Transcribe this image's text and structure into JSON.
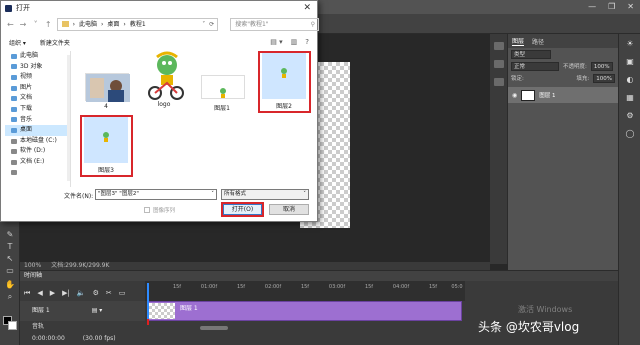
{
  "dialog": {
    "title": "打开",
    "close_glyph": "✕",
    "nav_back": "←",
    "nav_forward": "→",
    "nav_dropdown": "˅",
    "nav_up": "↑",
    "address": {
      "segments": [
        "›",
        "此电脑",
        "›",
        "桌面",
        "›",
        "教程1"
      ],
      "dropdown": "˅",
      "refresh": "⟳"
    },
    "search_placeholder": "搜索\"教程1\"",
    "search_icon": "⚲",
    "organize": "组织 ▾",
    "new_folder": "新建文件夹",
    "view_icons": [
      "▤ ▾",
      "▥",
      "?"
    ],
    "nav_items": [
      {
        "label": "此电脑",
        "kind": "pc"
      },
      {
        "label": "3D 对象",
        "kind": "folder"
      },
      {
        "label": "视频",
        "kind": "folder"
      },
      {
        "label": "图片",
        "kind": "folder"
      },
      {
        "label": "文档",
        "kind": "folder"
      },
      {
        "label": "下载",
        "kind": "folder"
      },
      {
        "label": "音乐",
        "kind": "folder"
      },
      {
        "label": "桌面",
        "kind": "folder"
      },
      {
        "label": "本地磁盘 (C:)",
        "kind": "drive"
      },
      {
        "label": "软件 (D:)",
        "kind": "drive"
      },
      {
        "label": "文档 (E:)",
        "kind": "drive"
      },
      {
        "label": "",
        "kind": "drive"
      }
    ],
    "selected_nav": "桌面",
    "files": [
      {
        "name": "4",
        "thumb": "photo",
        "selected": false
      },
      {
        "name": "logo",
        "thumb": "logo",
        "selected": false
      },
      {
        "name": "图层1",
        "thumb": "layer",
        "selected": false
      },
      {
        "name": "图层2",
        "thumb": "layer",
        "selected": true
      },
      {
        "name": "图层3",
        "thumb": "layer",
        "selected": true
      }
    ],
    "filename_label": "文件名(N):",
    "filename_value": "\"图层3\" \"图层2\"",
    "filename_dropdown": "˅",
    "filter_value": "所有格式",
    "filter_dropdown": "˅",
    "image_sequence_label": "图像序列",
    "open_label": "打开(O)",
    "cancel_label": "取消"
  },
  "photoshop": {
    "window_controls": [
      "—",
      "❐",
      "✕"
    ],
    "tools": [
      "✎",
      "T",
      "↖",
      "▭",
      "✋",
      "⌕"
    ],
    "status_zoom": "100%",
    "status_doc": "文档:299.9K/299.9K",
    "layers_panel": {
      "tabs": [
        "图层",
        "路径"
      ],
      "filter_label": "类型",
      "blend_mode": "正常",
      "opacity_label": "不透明度:",
      "opacity_value": "100%",
      "lock_label": "锁定:",
      "fill_label": "填充:",
      "fill_value": "100%",
      "layer_name": "图层 1"
    },
    "dock_icons": [
      "☀",
      "▣",
      "◐",
      "▦",
      "⚙",
      "◯"
    ]
  },
  "timeline": {
    "tab_label": "时间轴",
    "controls": [
      "⏮",
      "◀",
      "▶",
      "▶|",
      "🔈",
      "⚙",
      "✂",
      "▭"
    ],
    "ruler_ticks": [
      "15f",
      "01:00f",
      "15f",
      "02:00f",
      "15f",
      "03:00f",
      "15f",
      "04:00f",
      "15f",
      "05:0"
    ],
    "track_label": "图层 1",
    "track_menu": "▤ ▾",
    "clip_name": "图层 1",
    "audio_label": "音轨",
    "time_current": "0:00:00:00",
    "fps": "(30.00 fps)"
  },
  "watermark": {
    "activate": "激活 Windows",
    "text": "头条 @坎农哥vlog"
  },
  "colors": {
    "ps_dark": "#282828",
    "ps_panel": "#535353",
    "highlight_red": "#d8262b",
    "clip_purple": "#9d6fd1",
    "playhead_blue": "#2e8bff"
  }
}
